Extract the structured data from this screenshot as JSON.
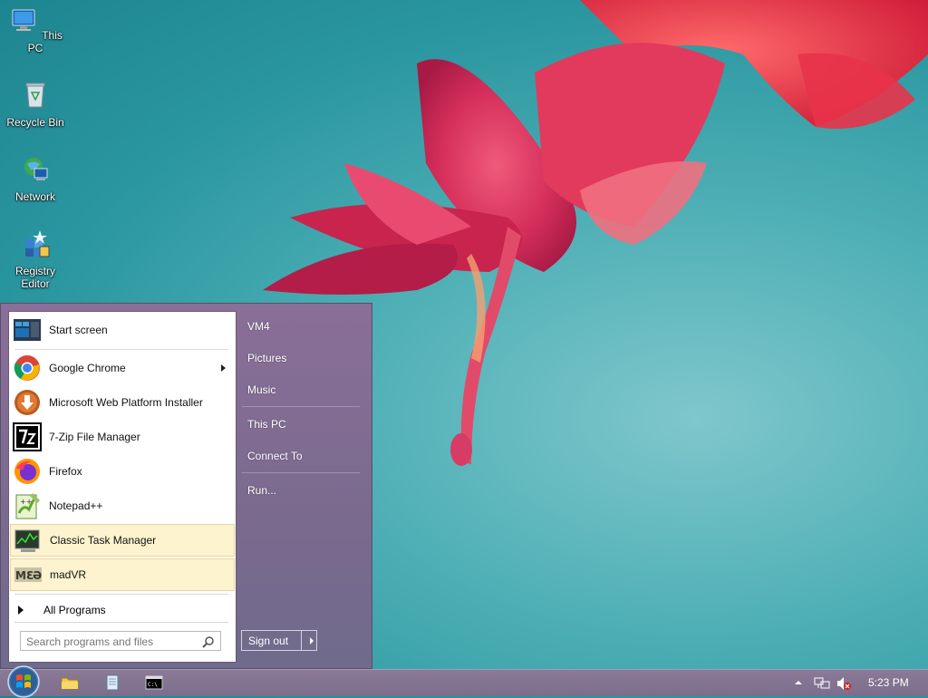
{
  "desktop": {
    "icons": [
      {
        "label": "This PC"
      },
      {
        "label": "Recycle Bin"
      },
      {
        "label": "Network"
      },
      {
        "label": "Registry Editor"
      }
    ]
  },
  "start_menu": {
    "programs": [
      {
        "label": "Start screen"
      },
      {
        "label": "Google Chrome"
      },
      {
        "label": "Microsoft Web Platform Installer"
      },
      {
        "label": "7-Zip File Manager"
      },
      {
        "label": "Firefox"
      },
      {
        "label": "Notepad++"
      },
      {
        "label": "Classic Task Manager"
      },
      {
        "label": "madVR"
      }
    ],
    "all_programs": "All Programs",
    "search_placeholder": "Search programs and files",
    "right_items": [
      "VM4",
      "Pictures",
      "Music",
      "This PC",
      "Connect To",
      "Run..."
    ],
    "sign_out": "Sign out"
  },
  "taskbar": {
    "clock": "5:23 PM"
  },
  "colors": {
    "highlight": "#fdf3cf",
    "taskbar": "#7b6e8c",
    "menu_right_pane": "#7a6a8e"
  }
}
